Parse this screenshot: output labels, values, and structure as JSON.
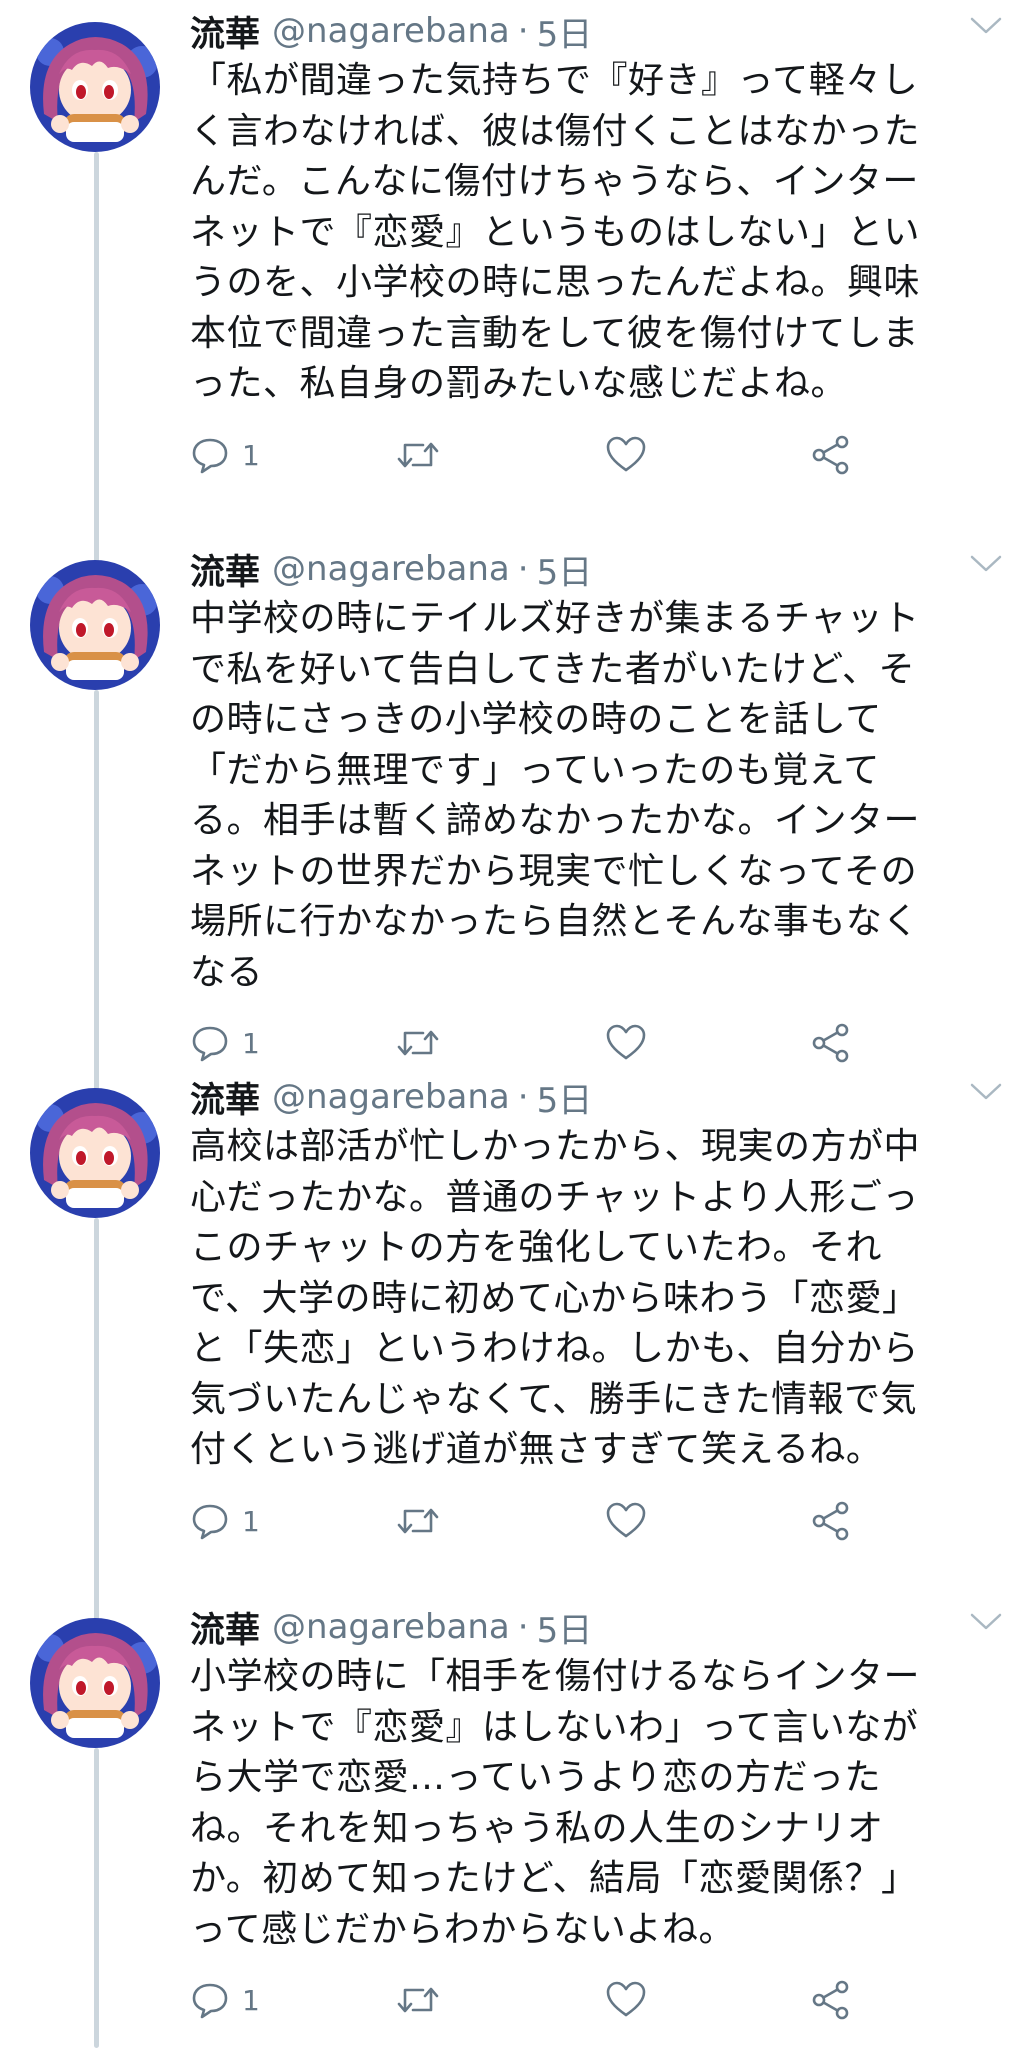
{
  "tweets": [
    {
      "display_name": "流華",
      "handle": "@nagarebana",
      "separator": "·",
      "time": "5日",
      "lines": [
        "「私が間違った気持ちで『好き』って軽々し",
        "く言わなければ、彼は傷付くことはなかった",
        "んだ。こんなに傷付けちゃうなら、インター",
        "ネットで『恋愛』というものはしない」とい",
        "うのを、小学校の時に思ったんだよね。興味",
        "本位で間違った言動をして彼を傷付けてしま",
        "った、私自身の罰みたいな感じだよね。"
      ],
      "reply_count": "1"
    },
    {
      "display_name": "流華",
      "handle": "@nagarebana",
      "separator": "·",
      "time": "5日",
      "lines": [
        "中学校の時にテイルズ好きが集まるチャット",
        "で私を好いて告白してきた者がいたけど、そ",
        "の時にさっきの小学校の時のことを話して",
        "「だから無理です」っていったのも覚えて",
        "る。相手は暫く諦めなかったかな。インター",
        "ネットの世界だから現実で忙しくなってその",
        "場所に行かなかったら自然とそんな事もなく",
        "なる"
      ],
      "reply_count": "1"
    },
    {
      "display_name": "流華",
      "handle": "@nagarebana",
      "separator": "·",
      "time": "5日",
      "lines": [
        "高校は部活が忙しかったから、現実の方が中",
        "心だったかな。普通のチャットより人形ごっ",
        "このチャットの方を強化していたわ。それ",
        "で、大学の時に初めて心から味わう「恋愛」",
        "と「失恋」というわけね。しかも、自分から",
        "気づいたんじゃなくて、勝手にきた情報で気",
        "付くという逃げ道が無さすぎて笑えるね。"
      ],
      "reply_count": "1"
    },
    {
      "display_name": "流華",
      "handle": "@nagarebana",
      "separator": "·",
      "time": "5日",
      "lines": [
        "小学校の時に「相手を傷付けるならインター",
        "ネットで『恋愛』はしないわ」って言いなが",
        "ら大学で恋愛…っていうより恋の方だった",
        "ね。それを知っちゃう私の人生のシナリオ",
        "か。初めて知ったけど、結局「恋愛関係？」",
        "って感じだからわからないよね。"
      ],
      "reply_count": "1"
    }
  ],
  "icons": {
    "avatar": "avatar-icon",
    "caret": "chevron-down-icon",
    "reply": "reply-icon",
    "retweet": "retweet-icon",
    "like": "heart-icon",
    "share": "share-icon"
  },
  "colors": {
    "text": "#14171a",
    "secondary": "#657786",
    "thread_line": "#ccd6dd",
    "avatar_bg": "#2a3fae",
    "hair": "#b34f8c"
  }
}
